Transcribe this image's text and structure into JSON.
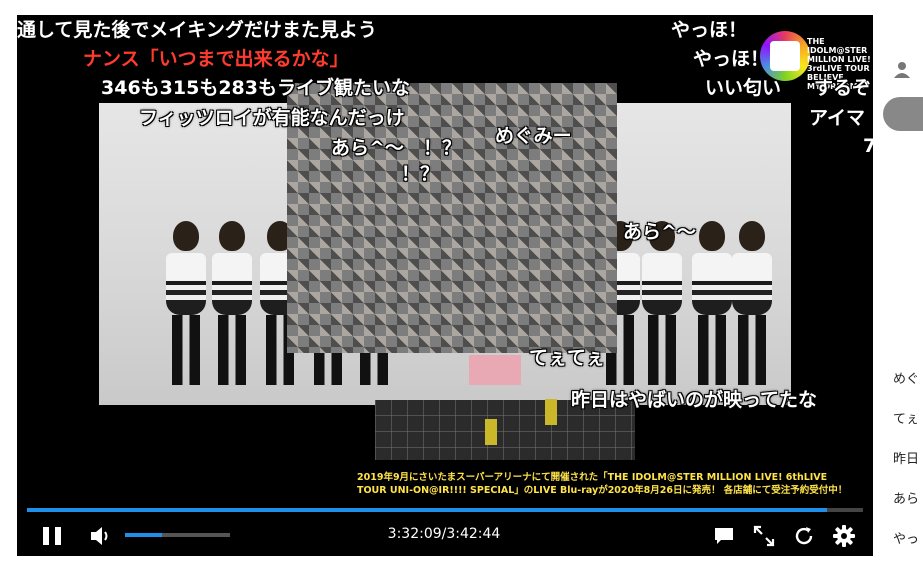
{
  "player": {
    "comments": [
      "通して見た後でメイキングだけまた見よう",
      "ナンス「いつまで出来るかな」",
      "346も315も283もライブ観たいな",
      "フィッツロイが有能なんだっけ",
      "あら^～",
      "！？",
      "めぐみー",
      "！？",
      "あら^～",
      "てぇてぇ",
      "昨日はやばいのが映ってたな",
      "やっほ！",
      "やっほ！",
      "いい匂い",
      "するぞ",
      "アイマ",
      "7"
    ],
    "logo_text": [
      "THE IDOLM@STER",
      "MILLION LIVE!",
      "3rdLIVE TOUR",
      "BELIEVE",
      "MY DRE@M!!"
    ],
    "caption_line1": "2019年9月にさいたまスーパーアリーナにて開催された「THE IDOLM@STER MILLION LIVE! 6thLIVE",
    "caption_line2": "TOUR UNI-ON@IR!!!! SPECIAL」のLIVE Blu-rayが2020年8月26日に発売！ 各店舗にて受注予約受付中！",
    "progress": 0.957,
    "volume": 0.35,
    "time_display": "3:32:09/3:42:44"
  },
  "sidebar": {
    "comments": [
      "めぐ",
      "てぇ",
      "昨日",
      "あら",
      "やっ"
    ]
  },
  "colors": {
    "accent": "#1f8fe8",
    "comment_red": "#ff3b30",
    "caption_yellow": "#ffe34a"
  }
}
